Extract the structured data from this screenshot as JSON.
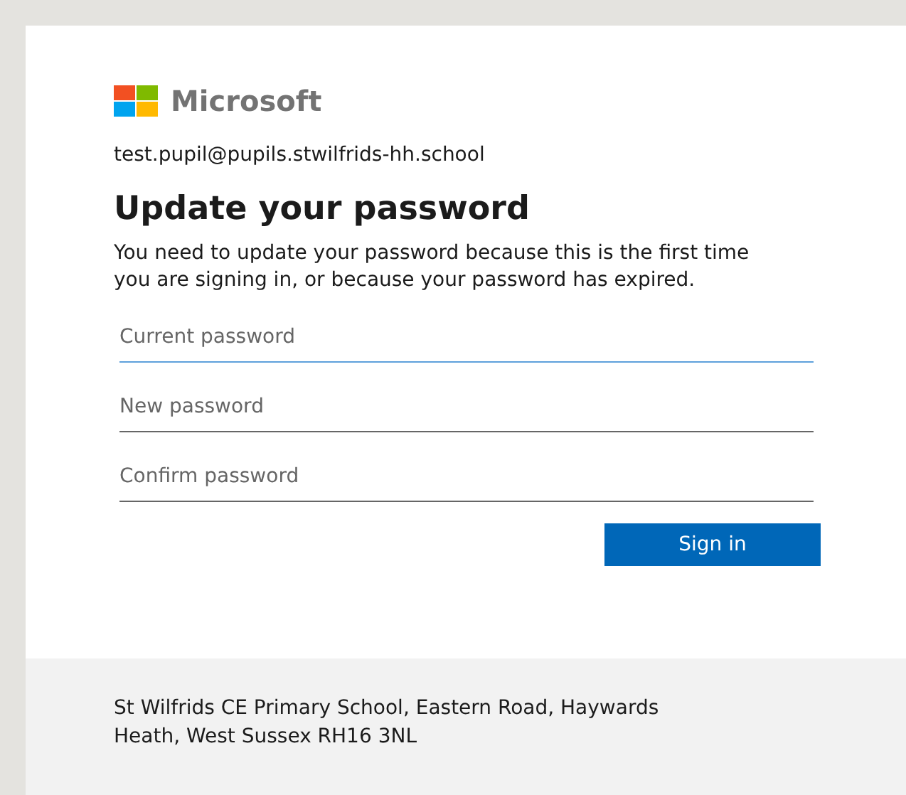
{
  "logo": {
    "text": "Microsoft"
  },
  "account": "test.pupil@pupils.stwilfrids-hh.school",
  "title": "Update your password",
  "message": "You need to update your password because this is the first time you are signing in, or because your password has expired.",
  "fields": [
    {
      "placeholder": "Current password",
      "focused": true
    },
    {
      "placeholder": "New password",
      "focused": false
    },
    {
      "placeholder": "Confirm password",
      "focused": false
    }
  ],
  "submit_button": "Sign in",
  "footer": "St Wilfrids CE Primary School, Eastern Road, Haywards Heath, West Sussex RH16 3NL"
}
